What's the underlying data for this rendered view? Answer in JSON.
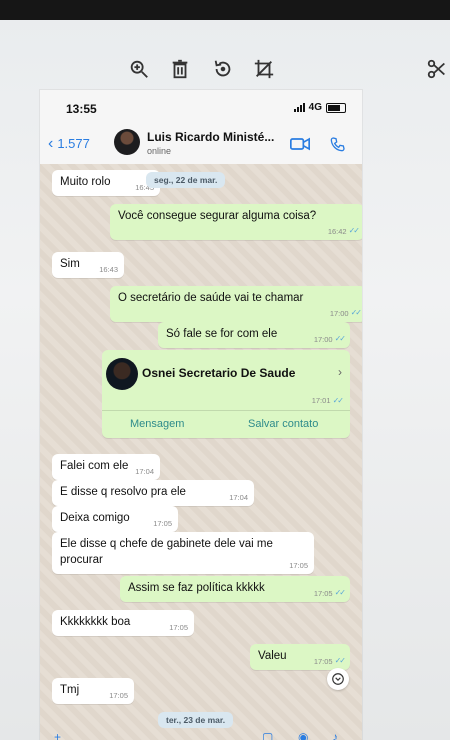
{
  "viewer": {
    "tools": [
      {
        "icon": "zoom-in-icon"
      },
      {
        "icon": "trash-icon"
      },
      {
        "icon": "rotate-icon"
      },
      {
        "icon": "crop-icon"
      },
      {
        "icon": "scissors-icon"
      }
    ]
  },
  "status": {
    "time": "13:55",
    "network": "4G"
  },
  "header": {
    "back_label": "1.577",
    "contact_name": "Luis Ricardo Ministé...",
    "contact_status": "online"
  },
  "messages": [
    {
      "dir": "in",
      "text": "Muito rolo",
      "time": "16:43"
    },
    {
      "date": "seg., 22 de mar."
    },
    {
      "dir": "out",
      "text": "Você consegue segurar alguma coisa?",
      "time": "16:42"
    },
    {
      "dir": "in",
      "text": "Sim",
      "time": "16:43"
    },
    {
      "dir": "out",
      "text": "O secretário de saúde vai te chamar",
      "time": "17:00"
    },
    {
      "dir": "out",
      "text": "Só fale se for com ele",
      "time": "17:00"
    },
    {
      "dir": "in",
      "text": "Falei com ele",
      "time": "17:04"
    },
    {
      "dir": "in",
      "text": "E disse q resolvo pra ele",
      "time": "17:04"
    },
    {
      "dir": "in",
      "text": "Deixa comigo",
      "time": "17:05"
    },
    {
      "dir": "in",
      "text": "Ele disse q chefe de gabinete dele vai me procurar",
      "time": "17:05"
    },
    {
      "dir": "out",
      "text": "Assim se faz política kkkkk",
      "time": "17:05"
    },
    {
      "dir": "in",
      "text": "Kkkkkkkk boa",
      "time": "17:05"
    },
    {
      "dir": "out",
      "text": "Valeu",
      "time": "17:05"
    },
    {
      "dir": "in",
      "text": "Tmj",
      "time": "17:05"
    },
    {
      "date": "ter., 23 de mar."
    }
  ],
  "contact_card": {
    "name": "Osnei Secretario De Saude",
    "time": "17:01",
    "message_label": "Mensagem",
    "save_label": "Salvar contato"
  },
  "colors": {
    "outgoing": "#dcf7c5",
    "incoming": "#ffffff",
    "accent": "#2a7de1",
    "chat_bg": "#e4dbd0"
  }
}
